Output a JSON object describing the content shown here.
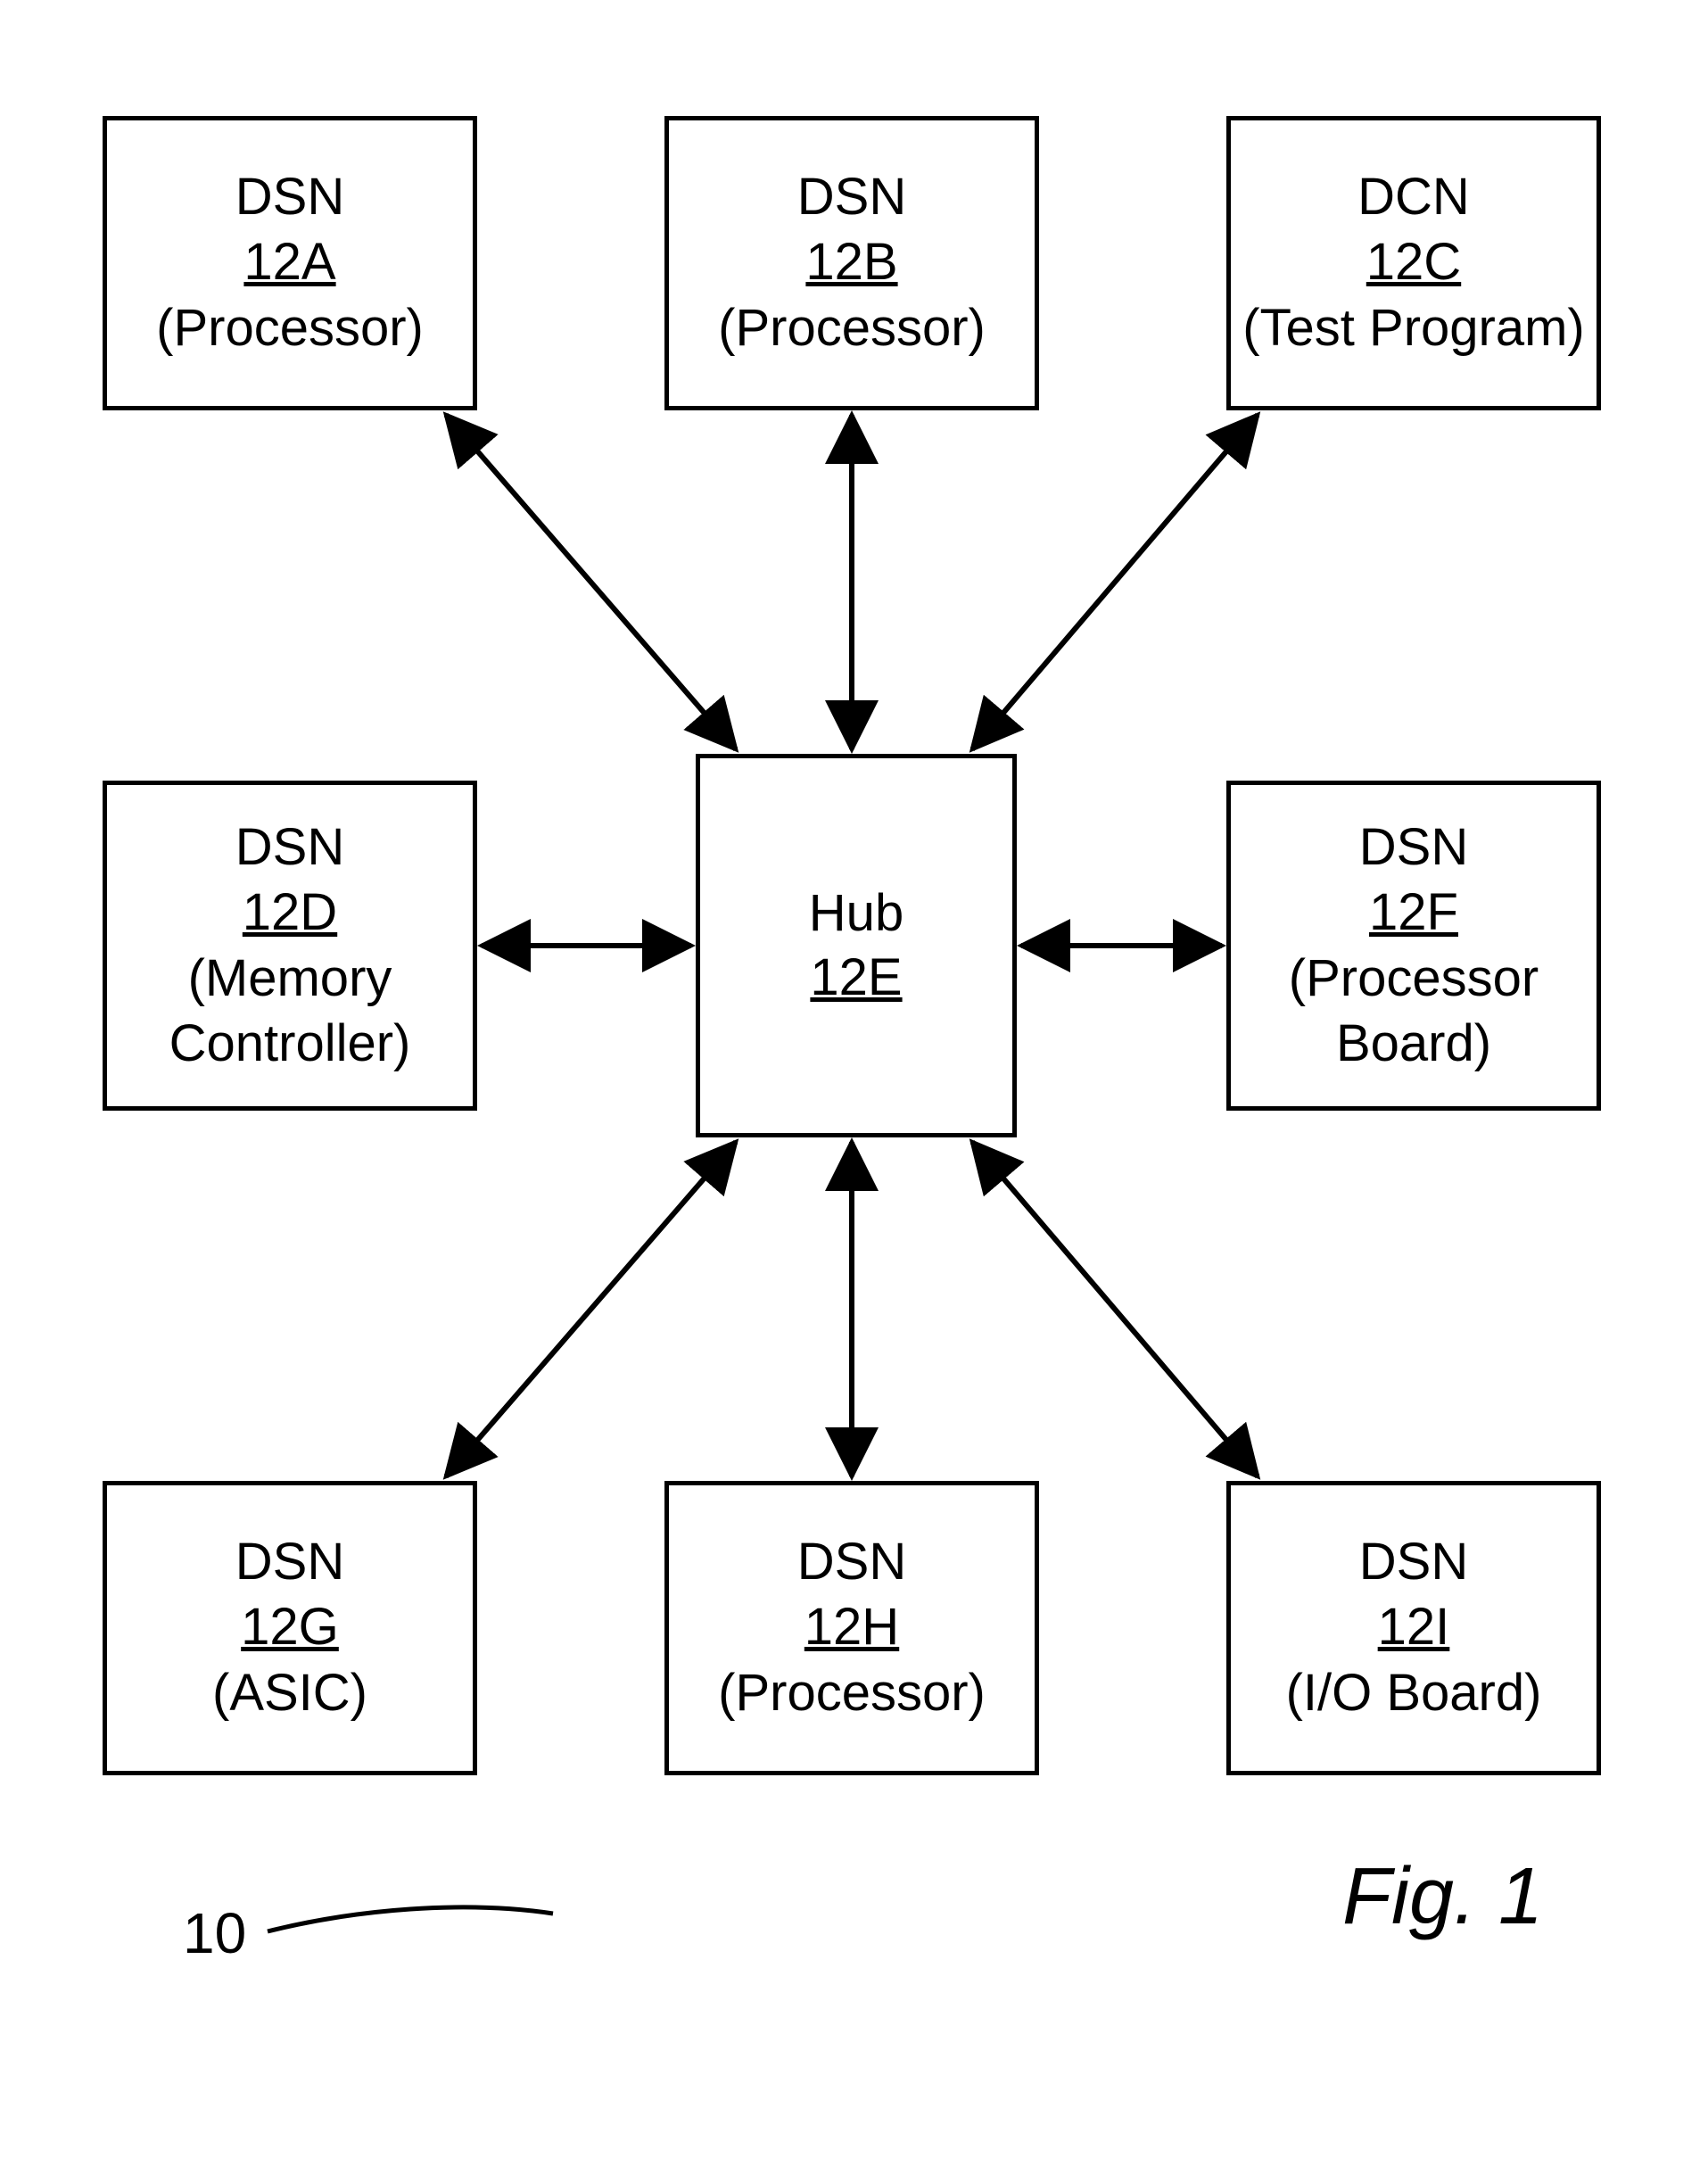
{
  "nodes": {
    "A": {
      "l1": "DSN",
      "l2": "12A",
      "l3": "(Processor)"
    },
    "B": {
      "l1": "DSN",
      "l2": "12B",
      "l3": "(Processor)"
    },
    "C": {
      "l1": "DCN",
      "l2": "12C",
      "l3": "(Test Program)"
    },
    "D": {
      "l1": "DSN",
      "l2": "12D",
      "l3": "(Memory Controller)"
    },
    "E": {
      "l1": "Hub",
      "l2": "12E",
      "l3": ""
    },
    "F": {
      "l1": "DSN",
      "l2": "12F",
      "l3": "(Processor Board)"
    },
    "G": {
      "l1": "DSN",
      "l2": "12G",
      "l3": "(ASIC)"
    },
    "H": {
      "l1": "DSN",
      "l2": "12H",
      "l3": "(Processor)"
    },
    "I": {
      "l1": "DSN",
      "l2": "12I",
      "l3": "(I/O Board)"
    }
  },
  "ref": "10",
  "figure": "Fig. 1",
  "chart_data": {
    "type": "diagram",
    "title": "Fig. 1",
    "reference_numeral": "10",
    "topology": "hub-and-spoke",
    "hub": {
      "id": "12E",
      "label": "Hub"
    },
    "spokes": [
      {
        "id": "12A",
        "kind": "DSN",
        "label": "Processor"
      },
      {
        "id": "12B",
        "kind": "DSN",
        "label": "Processor"
      },
      {
        "id": "12C",
        "kind": "DCN",
        "label": "Test Program"
      },
      {
        "id": "12D",
        "kind": "DSN",
        "label": "Memory Controller"
      },
      {
        "id": "12F",
        "kind": "DSN",
        "label": "Processor Board"
      },
      {
        "id": "12G",
        "kind": "DSN",
        "label": "ASIC"
      },
      {
        "id": "12H",
        "kind": "DSN",
        "label": "Processor"
      },
      {
        "id": "12I",
        "kind": "DSN",
        "label": "I/O Board"
      }
    ],
    "edges": [
      {
        "from": "12E",
        "to": "12A",
        "bidirectional": true
      },
      {
        "from": "12E",
        "to": "12B",
        "bidirectional": true
      },
      {
        "from": "12E",
        "to": "12C",
        "bidirectional": true
      },
      {
        "from": "12E",
        "to": "12D",
        "bidirectional": true
      },
      {
        "from": "12E",
        "to": "12F",
        "bidirectional": true
      },
      {
        "from": "12E",
        "to": "12G",
        "bidirectional": true
      },
      {
        "from": "12E",
        "to": "12H",
        "bidirectional": true
      },
      {
        "from": "12E",
        "to": "12I",
        "bidirectional": true
      }
    ]
  }
}
